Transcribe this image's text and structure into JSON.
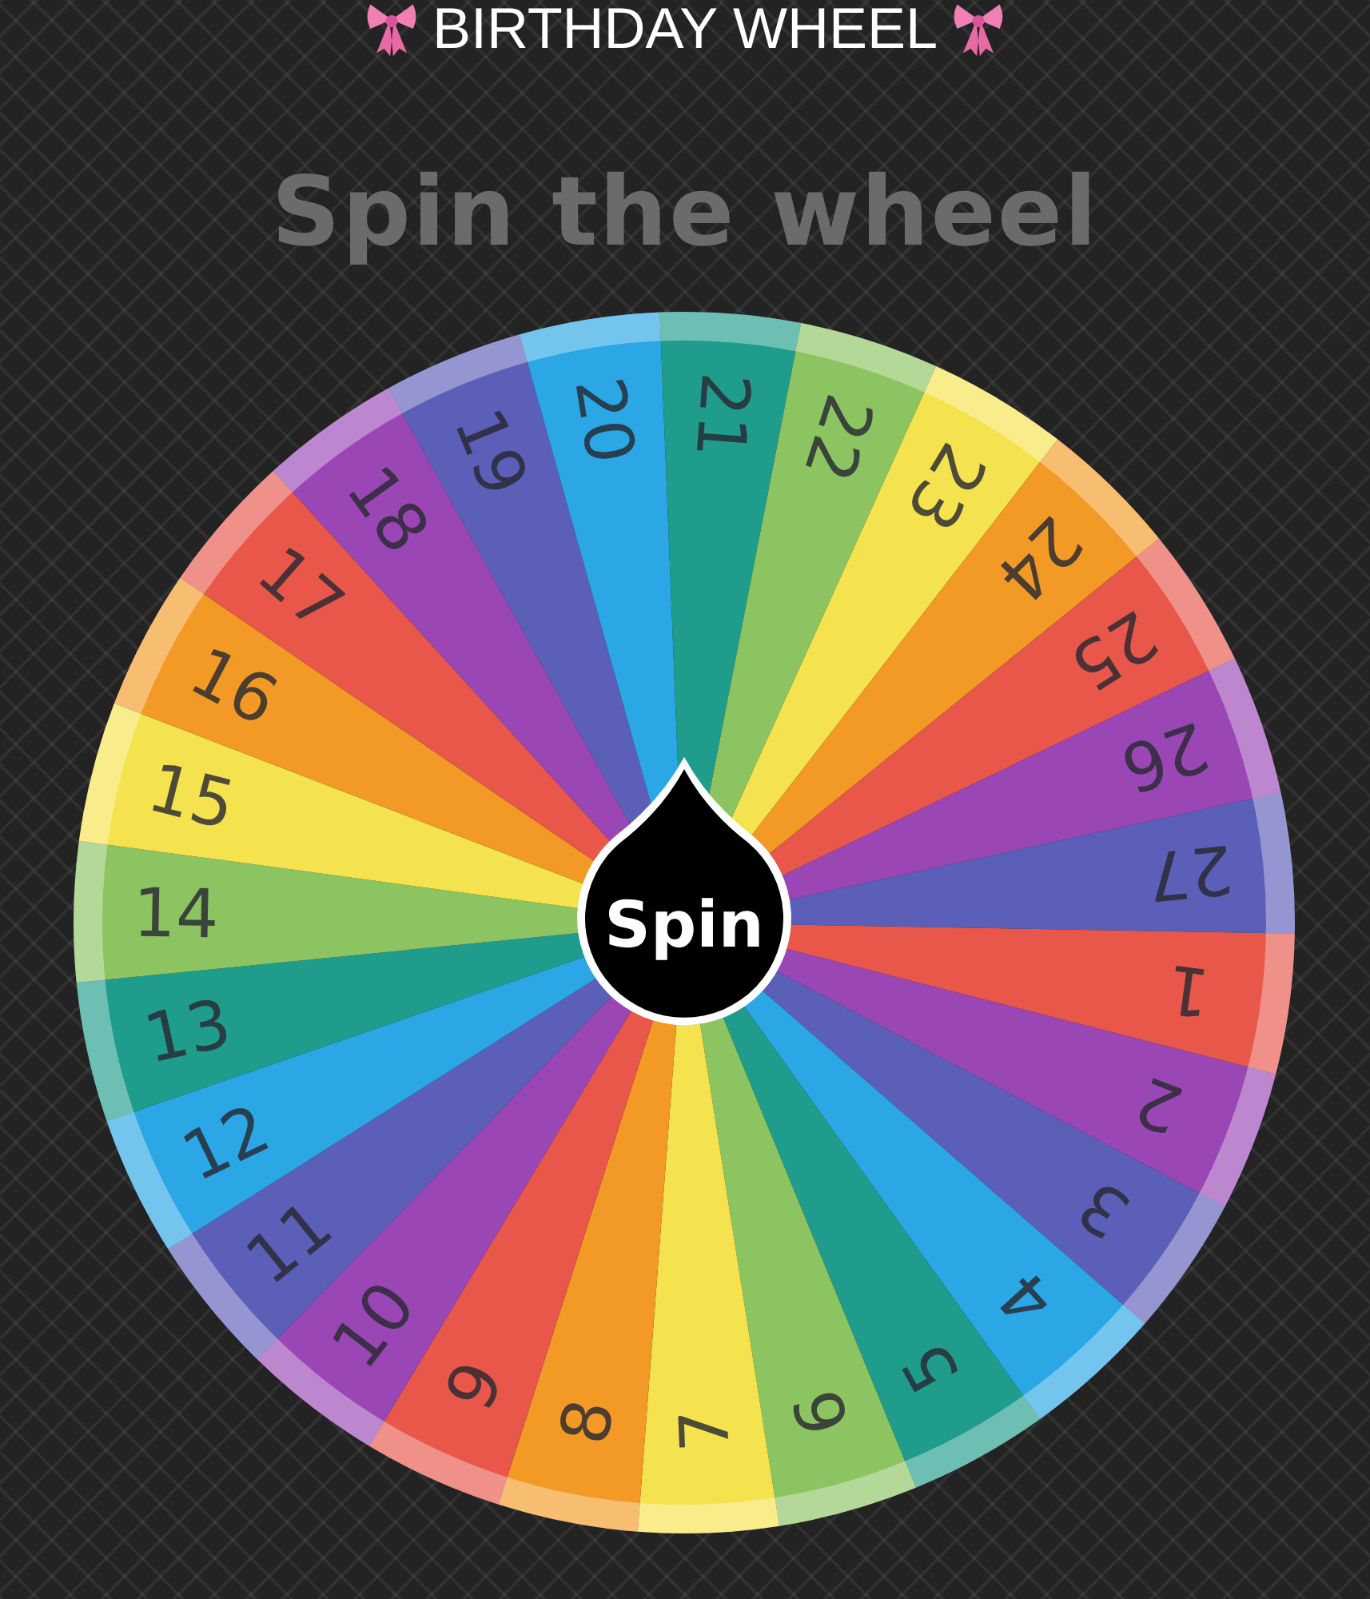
{
  "header": {
    "title": "BIRTHDAY WHEEL"
  },
  "subtitle": "Spin the wheel",
  "wheel": {
    "segments": [
      {
        "label": "1",
        "color": "#e8574a"
      },
      {
        "label": "2",
        "color": "#9a47b5"
      },
      {
        "label": "3",
        "color": "#5c5fb8"
      },
      {
        "label": "4",
        "color": "#2aa7e4"
      },
      {
        "label": "5",
        "color": "#1f9c8b"
      },
      {
        "label": "6",
        "color": "#8cc461"
      },
      {
        "label": "7",
        "color": "#f4e24e"
      },
      {
        "label": "8",
        "color": "#f39a26"
      },
      {
        "label": "9",
        "color": "#e8574a"
      },
      {
        "label": "10",
        "color": "#9a47b5"
      },
      {
        "label": "11",
        "color": "#5c5fb8"
      },
      {
        "label": "12",
        "color": "#2aa7e4"
      },
      {
        "label": "13",
        "color": "#1f9c8b"
      },
      {
        "label": "14",
        "color": "#8cc461"
      },
      {
        "label": "15",
        "color": "#f4e24e"
      },
      {
        "label": "16",
        "color": "#f39a26"
      },
      {
        "label": "17",
        "color": "#e8574a"
      },
      {
        "label": "18",
        "color": "#9a47b5"
      },
      {
        "label": "19",
        "color": "#5c5fb8"
      },
      {
        "label": "20",
        "color": "#2aa7e4"
      },
      {
        "label": "21",
        "color": "#1f9c8b"
      },
      {
        "label": "22",
        "color": "#8cc461"
      },
      {
        "label": "23",
        "color": "#f4e24e"
      },
      {
        "label": "24",
        "color": "#f39a26"
      },
      {
        "label": "25",
        "color": "#e8574a"
      },
      {
        "label": "26",
        "color": "#9a47b5"
      },
      {
        "label": "27",
        "color": "#5c5fb8"
      }
    ],
    "spin_button": "Spin"
  }
}
